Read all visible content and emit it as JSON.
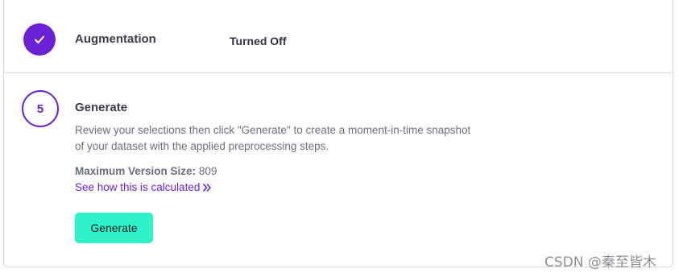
{
  "augmentation": {
    "title": "Augmentation",
    "status": "Turned Off",
    "icon": "check-icon"
  },
  "generate": {
    "step_number": "5",
    "title": "Generate",
    "description": "Review your selections then click \"Generate\" to create a moment-in-time snapshot of your dataset with the applied preprocessing steps.",
    "max_size_label": "Maximum Version Size:",
    "max_size_value": "809",
    "calc_link": "See how this is calculated",
    "calc_link_icon": "double-chevron-right-icon",
    "button_label": "Generate"
  },
  "watermark": "CSDN @秦至皆木",
  "colors": {
    "accent": "#6b21d6",
    "button": "#2ef2c8",
    "border": "#d9dadf"
  }
}
